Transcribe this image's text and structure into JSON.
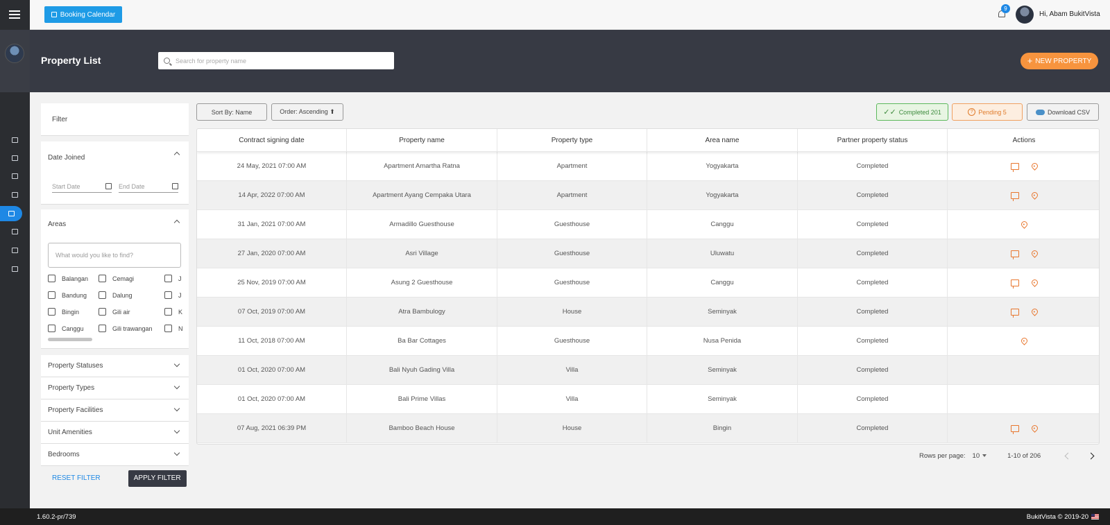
{
  "header": {
    "booking_calendar_label": "Booking Calendar",
    "notification_count": "9",
    "greeting": "Hi, Abam BukitVista"
  },
  "band": {
    "title": "Property List",
    "search_placeholder": "Search for property name",
    "new_property_label": "NEW PROPERTY"
  },
  "filter": {
    "title": "Filter",
    "date_joined": {
      "label": "Date Joined",
      "start_placeholder": "Start Date",
      "end_placeholder": "End Date"
    },
    "areas": {
      "label": "Areas",
      "placeholder": "What would you like to find?",
      "options": [
        "Balangan",
        "Cemagi",
        "J",
        "Bandung",
        "Dalung",
        "J",
        "Bingin",
        "Gili air",
        "K",
        "Canggu",
        "Gili trawangan",
        "N"
      ]
    },
    "collapsed_sections": [
      "Property Statuses",
      "Property Types",
      "Property Facilities",
      "Unit Amenities",
      "Bedrooms"
    ],
    "reset_label": "RESET FILTER",
    "apply_label": "APPLY FILTER"
  },
  "toolbar": {
    "sort_label": "Sort By: Name",
    "order_label": "Order: Ascending ⬆",
    "completed_label": "Completed 201",
    "pending_label": "Pending 5",
    "download_label": "Download CSV"
  },
  "table": {
    "columns": [
      "Contract signing date",
      "Property name",
      "Property type",
      "Area name",
      "Partner property status",
      "Actions"
    ],
    "rows": [
      {
        "date": "24 May, 2021 07:00 AM",
        "name": "Apartment Amartha Ratna",
        "type": "Apartment",
        "area": "Yogyakarta",
        "status": "Completed",
        "chat": true,
        "pin": true
      },
      {
        "date": "14 Apr, 2022 07:00 AM",
        "name": "Apartment Ayang Cempaka Utara",
        "type": "Apartment",
        "area": "Yogyakarta",
        "status": "Completed",
        "chat": true,
        "pin": true
      },
      {
        "date": "31 Jan, 2021 07:00 AM",
        "name": "Armadillo Guesthouse",
        "type": "Guesthouse",
        "area": "Canggu",
        "status": "Completed",
        "chat": false,
        "pin": true
      },
      {
        "date": "27 Jan, 2020 07:00 AM",
        "name": "Asri Village",
        "type": "Guesthouse",
        "area": "Uluwatu",
        "status": "Completed",
        "chat": true,
        "pin": true
      },
      {
        "date": "25 Nov, 2019 07:00 AM",
        "name": "Asung 2 Guesthouse",
        "type": "Guesthouse",
        "area": "Canggu",
        "status": "Completed",
        "chat": true,
        "pin": true
      },
      {
        "date": "07 Oct, 2019 07:00 AM",
        "name": "Atra Bambulogy",
        "type": "House",
        "area": "Seminyak",
        "status": "Completed",
        "chat": true,
        "pin": true
      },
      {
        "date": "11 Oct, 2018 07:00 AM",
        "name": "Ba Bar Cottages",
        "type": "Guesthouse",
        "area": "Nusa Penida",
        "status": "Completed",
        "chat": false,
        "pin": true
      },
      {
        "date": "01 Oct, 2020 07:00 AM",
        "name": "Bali Nyuh Gading Villa",
        "type": "Villa",
        "area": "Seminyak",
        "status": "Completed",
        "chat": false,
        "pin": false
      },
      {
        "date": "01 Oct, 2020 07:00 AM",
        "name": "Bali Prime Villas",
        "type": "Villa",
        "area": "Seminyak",
        "status": "Completed",
        "chat": false,
        "pin": false
      },
      {
        "date": "07 Aug, 2021 06:39 PM",
        "name": "Bamboo Beach House",
        "type": "House",
        "area": "Bingin",
        "status": "Completed",
        "chat": true,
        "pin": true
      }
    ]
  },
  "pagination": {
    "rows_per_page_label": "Rows per page:",
    "rows_per_page": "10",
    "range": "1-10 of 206"
  },
  "footer": {
    "version": "1.60.2-pr/739",
    "copyright": "BukitVista © 2019-20"
  },
  "colors": {
    "accent_blue": "#1e9be6",
    "accent_orange": "#f7943e",
    "action_icon": "#e8762d",
    "sidebar": "#2b2d31",
    "band": "#373a44"
  },
  "icons": {
    "sidebar": [
      "dashboard-icon",
      "list-icon",
      "card-icon",
      "calendar-check-icon",
      "home-icon",
      "document-icon",
      "users-icon",
      "book-icon"
    ],
    "actions": [
      "chat-icon",
      "map-pin-icon"
    ]
  }
}
